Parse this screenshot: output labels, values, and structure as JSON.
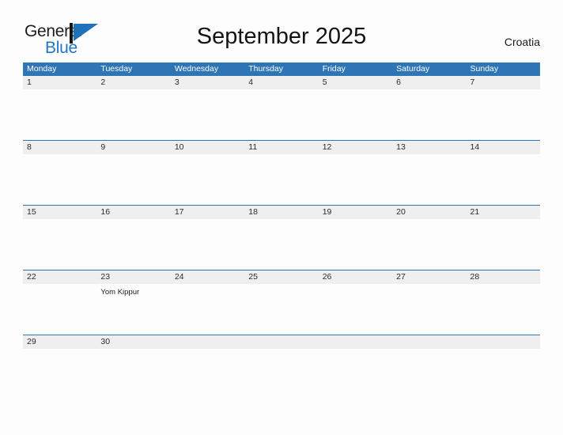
{
  "brand": {
    "name_top": "General",
    "name_bottom": "Blue",
    "mark_icon": "flag-triangle-icon",
    "color_top": "#1d1d1d",
    "color_bottom": "#2176c7"
  },
  "header": {
    "title": "September 2025",
    "country": "Croatia"
  },
  "colors": {
    "header_blue": "#2e75b6",
    "number_band_gray": "#efefef",
    "page_background": "#fdfdfd",
    "text": "#1a1a1a"
  },
  "calendar": {
    "weekdays": [
      "Monday",
      "Tuesday",
      "Wednesday",
      "Thursday",
      "Friday",
      "Saturday",
      "Sunday"
    ],
    "weeks": [
      {
        "days": [
          {
            "number": "1",
            "events": []
          },
          {
            "number": "2",
            "events": []
          },
          {
            "number": "3",
            "events": []
          },
          {
            "number": "4",
            "events": []
          },
          {
            "number": "5",
            "events": []
          },
          {
            "number": "6",
            "events": []
          },
          {
            "number": "7",
            "events": []
          }
        ]
      },
      {
        "days": [
          {
            "number": "8",
            "events": []
          },
          {
            "number": "9",
            "events": []
          },
          {
            "number": "10",
            "events": []
          },
          {
            "number": "11",
            "events": []
          },
          {
            "number": "12",
            "events": []
          },
          {
            "number": "13",
            "events": []
          },
          {
            "number": "14",
            "events": []
          }
        ]
      },
      {
        "days": [
          {
            "number": "15",
            "events": []
          },
          {
            "number": "16",
            "events": []
          },
          {
            "number": "17",
            "events": []
          },
          {
            "number": "18",
            "events": []
          },
          {
            "number": "19",
            "events": []
          },
          {
            "number": "20",
            "events": []
          },
          {
            "number": "21",
            "events": []
          }
        ]
      },
      {
        "days": [
          {
            "number": "22",
            "events": []
          },
          {
            "number": "23",
            "events": [
              "Yom Kippur"
            ]
          },
          {
            "number": "24",
            "events": []
          },
          {
            "number": "25",
            "events": []
          },
          {
            "number": "26",
            "events": []
          },
          {
            "number": "27",
            "events": []
          },
          {
            "number": "28",
            "events": []
          }
        ]
      },
      {
        "days": [
          {
            "number": "29",
            "events": []
          },
          {
            "number": "30",
            "events": []
          },
          {
            "number": "",
            "events": []
          },
          {
            "number": "",
            "events": []
          },
          {
            "number": "",
            "events": []
          },
          {
            "number": "",
            "events": []
          },
          {
            "number": "",
            "events": []
          }
        ]
      }
    ]
  }
}
